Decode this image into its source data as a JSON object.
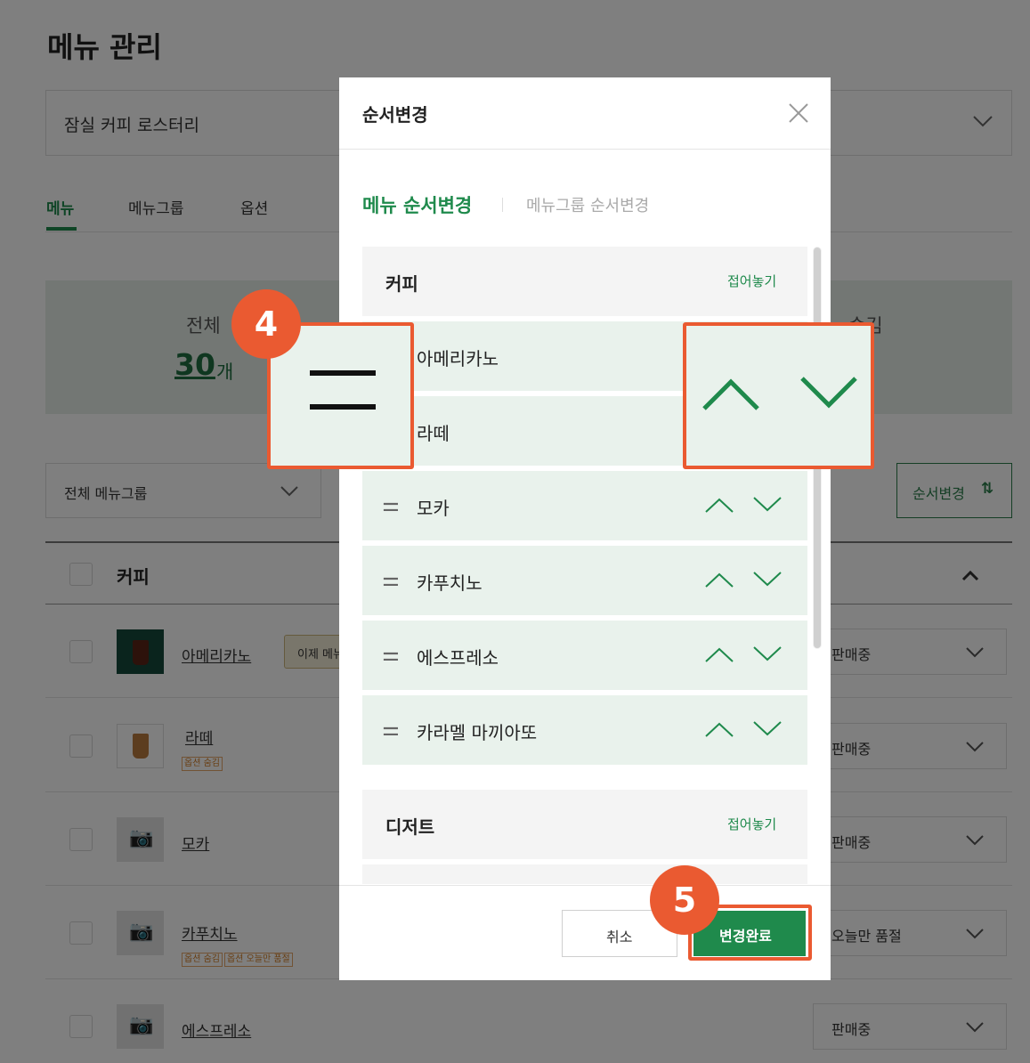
{
  "page": {
    "title": "메뉴 관리",
    "store_select": "잠실 커피 로스터리",
    "tabs": [
      "메뉴",
      "메뉴그룹",
      "옵션"
    ],
    "hidden_label": "숨김",
    "total_label": "전체",
    "total_count": "30",
    "total_unit": "개",
    "group_filter": "전체 메뉴그룹",
    "reorder_button": "순서변경",
    "group_header": "커피",
    "rows": [
      {
        "name": "아메리카노",
        "tooltip": "이제 메뉴",
        "status": "판매중",
        "tags": []
      },
      {
        "name": "라떼",
        "status": "판매중",
        "tags": [
          "옵션 숨김"
        ]
      },
      {
        "name": "모카",
        "status": "판매중",
        "tags": []
      },
      {
        "name": "카푸치노",
        "status": "오늘만 품절",
        "tags": [
          "옵션 숨김",
          "옵션 오늘만 품절"
        ]
      },
      {
        "name": "에스프레소",
        "status": "판매중",
        "tags": []
      }
    ]
  },
  "modal": {
    "title": "순서변경",
    "tab_active": "메뉴 순서변경",
    "tab_inactive": "메뉴그룹 순서변경",
    "groups": [
      {
        "name": "커피",
        "collapse_label": "접어놓기"
      },
      {
        "name": "디저트",
        "collapse_label": "접어놓기"
      }
    ],
    "items": [
      "아메리카노",
      "라떼",
      "모카",
      "카푸치노",
      "에스프레소",
      "카라멜 마끼아또"
    ],
    "cancel": "취소",
    "confirm": "변경완료"
  },
  "annotations": {
    "step4": "4",
    "step5": "5"
  },
  "colors": {
    "accent": "#1f8a4c",
    "annotation": "#ea5a31",
    "overlay": "rgba(0,0,0,0.5)"
  }
}
